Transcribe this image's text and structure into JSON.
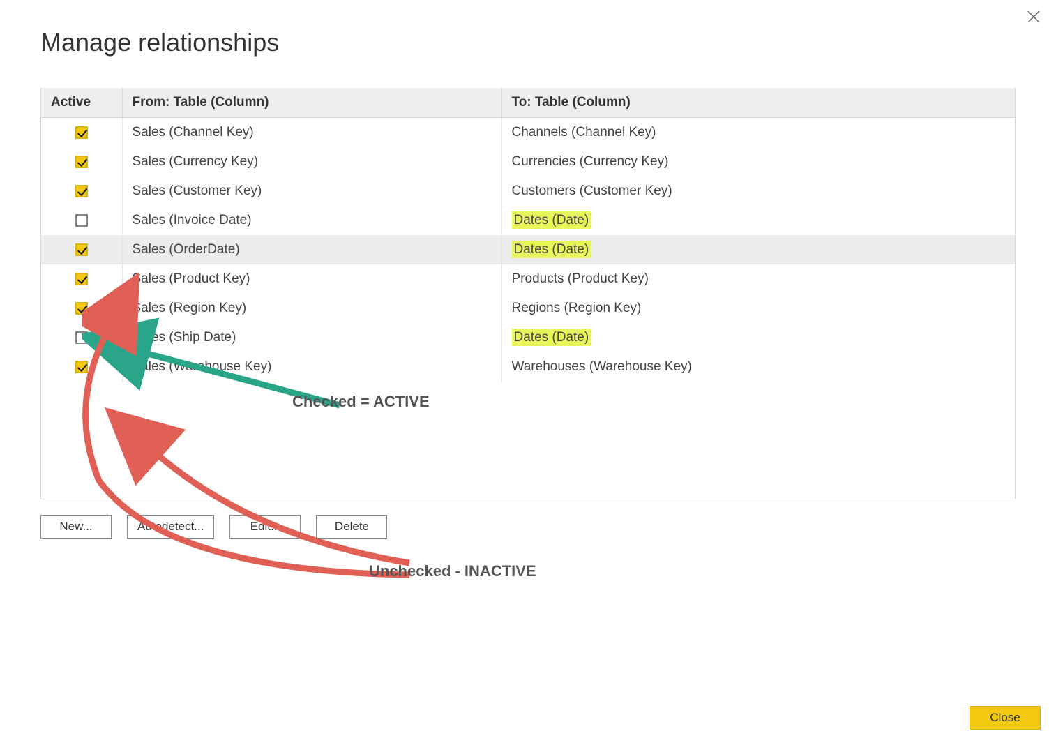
{
  "dialog": {
    "title": "Manage relationships",
    "headers": {
      "active": "Active",
      "from": "From: Table (Column)",
      "to": "To: Table (Column)"
    },
    "rows": [
      {
        "checked": true,
        "selected": false,
        "from": "Sales (Channel Key)",
        "to": "Channels (Channel Key)",
        "to_hl": false
      },
      {
        "checked": true,
        "selected": false,
        "from": "Sales (Currency Key)",
        "to": "Currencies (Currency Key)",
        "to_hl": false
      },
      {
        "checked": true,
        "selected": false,
        "from": "Sales (Customer Key)",
        "to": "Customers (Customer Key)",
        "to_hl": false
      },
      {
        "checked": false,
        "selected": false,
        "from": "Sales (Invoice Date)",
        "to": "Dates (Date)",
        "to_hl": true
      },
      {
        "checked": true,
        "selected": true,
        "from": "Sales (OrderDate)",
        "to": "Dates (Date)",
        "to_hl": true
      },
      {
        "checked": true,
        "selected": false,
        "from": "Sales (Product Key)",
        "to": "Products (Product Key)",
        "to_hl": false
      },
      {
        "checked": true,
        "selected": false,
        "from": "Sales (Region Key)",
        "to": "Regions (Region Key)",
        "to_hl": false
      },
      {
        "checked": false,
        "selected": false,
        "from": "Sales (Ship Date)",
        "to": "Dates (Date)",
        "to_hl": true
      },
      {
        "checked": true,
        "selected": false,
        "from": "Sales (Warehouse Key)",
        "to": "Warehouses (Warehouse Key)",
        "to_hl": false
      }
    ],
    "buttons": {
      "new": "New...",
      "autodetect": "Autodetect...",
      "edit": "Edit...",
      "delete": "Delete",
      "close": "Close"
    }
  },
  "annotations": {
    "checked_label": "Checked = ACTIVE",
    "unchecked_label": "Unchecked - INACTIVE",
    "colors": {
      "checked_arrow": "#2aa58a",
      "unchecked_arrow": "#e06055"
    }
  }
}
